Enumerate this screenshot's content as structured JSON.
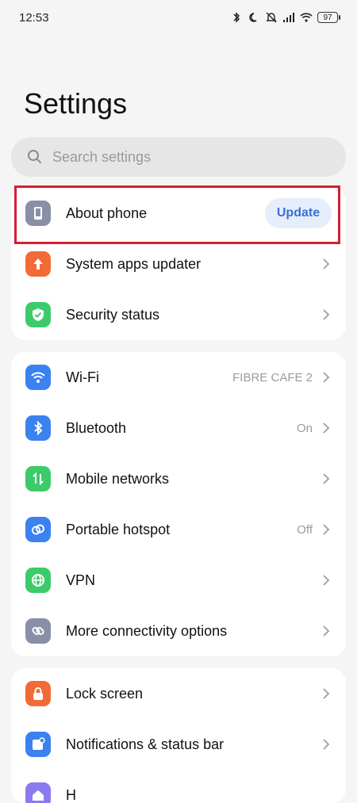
{
  "status_bar": {
    "time": "12:53",
    "battery": "97"
  },
  "page_title": "Settings",
  "search": {
    "placeholder": "Search settings"
  },
  "colors": {
    "about": "#8a8fa8",
    "system_apps": "#f26a35",
    "security": "#3ccb6b",
    "wifi": "#3b82f0",
    "bluetooth": "#3b82f0",
    "mobile": "#3ccb6b",
    "hotspot": "#3b82f0",
    "vpn": "#3ccb6b",
    "more_conn": "#8a8fa8",
    "lock": "#f26a35",
    "notifications": "#3b82f0",
    "home": "#8a7cf0",
    "highlight": "#d32030"
  },
  "group1": [
    {
      "label": "About phone",
      "action": "Update",
      "icon": "phone-icon"
    },
    {
      "label": "System apps updater",
      "icon": "arrow-up-icon"
    },
    {
      "label": "Security status",
      "icon": "shield-check-icon"
    }
  ],
  "group2": [
    {
      "label": "Wi-Fi",
      "value": "FIBRE CAFE 2",
      "icon": "wifi-icon"
    },
    {
      "label": "Bluetooth",
      "value": "On",
      "icon": "bluetooth-icon"
    },
    {
      "label": "Mobile networks",
      "icon": "mobile-data-icon"
    },
    {
      "label": "Portable hotspot",
      "value": "Off",
      "icon": "hotspot-icon"
    },
    {
      "label": "VPN",
      "icon": "globe-icon"
    },
    {
      "label": "More connectivity options",
      "icon": "link-icon"
    }
  ],
  "group3": [
    {
      "label": "Lock screen",
      "icon": "lock-icon"
    },
    {
      "label": "Notifications & status bar",
      "icon": "notification-icon"
    },
    {
      "label": "H",
      "icon": "home-icon"
    }
  ]
}
